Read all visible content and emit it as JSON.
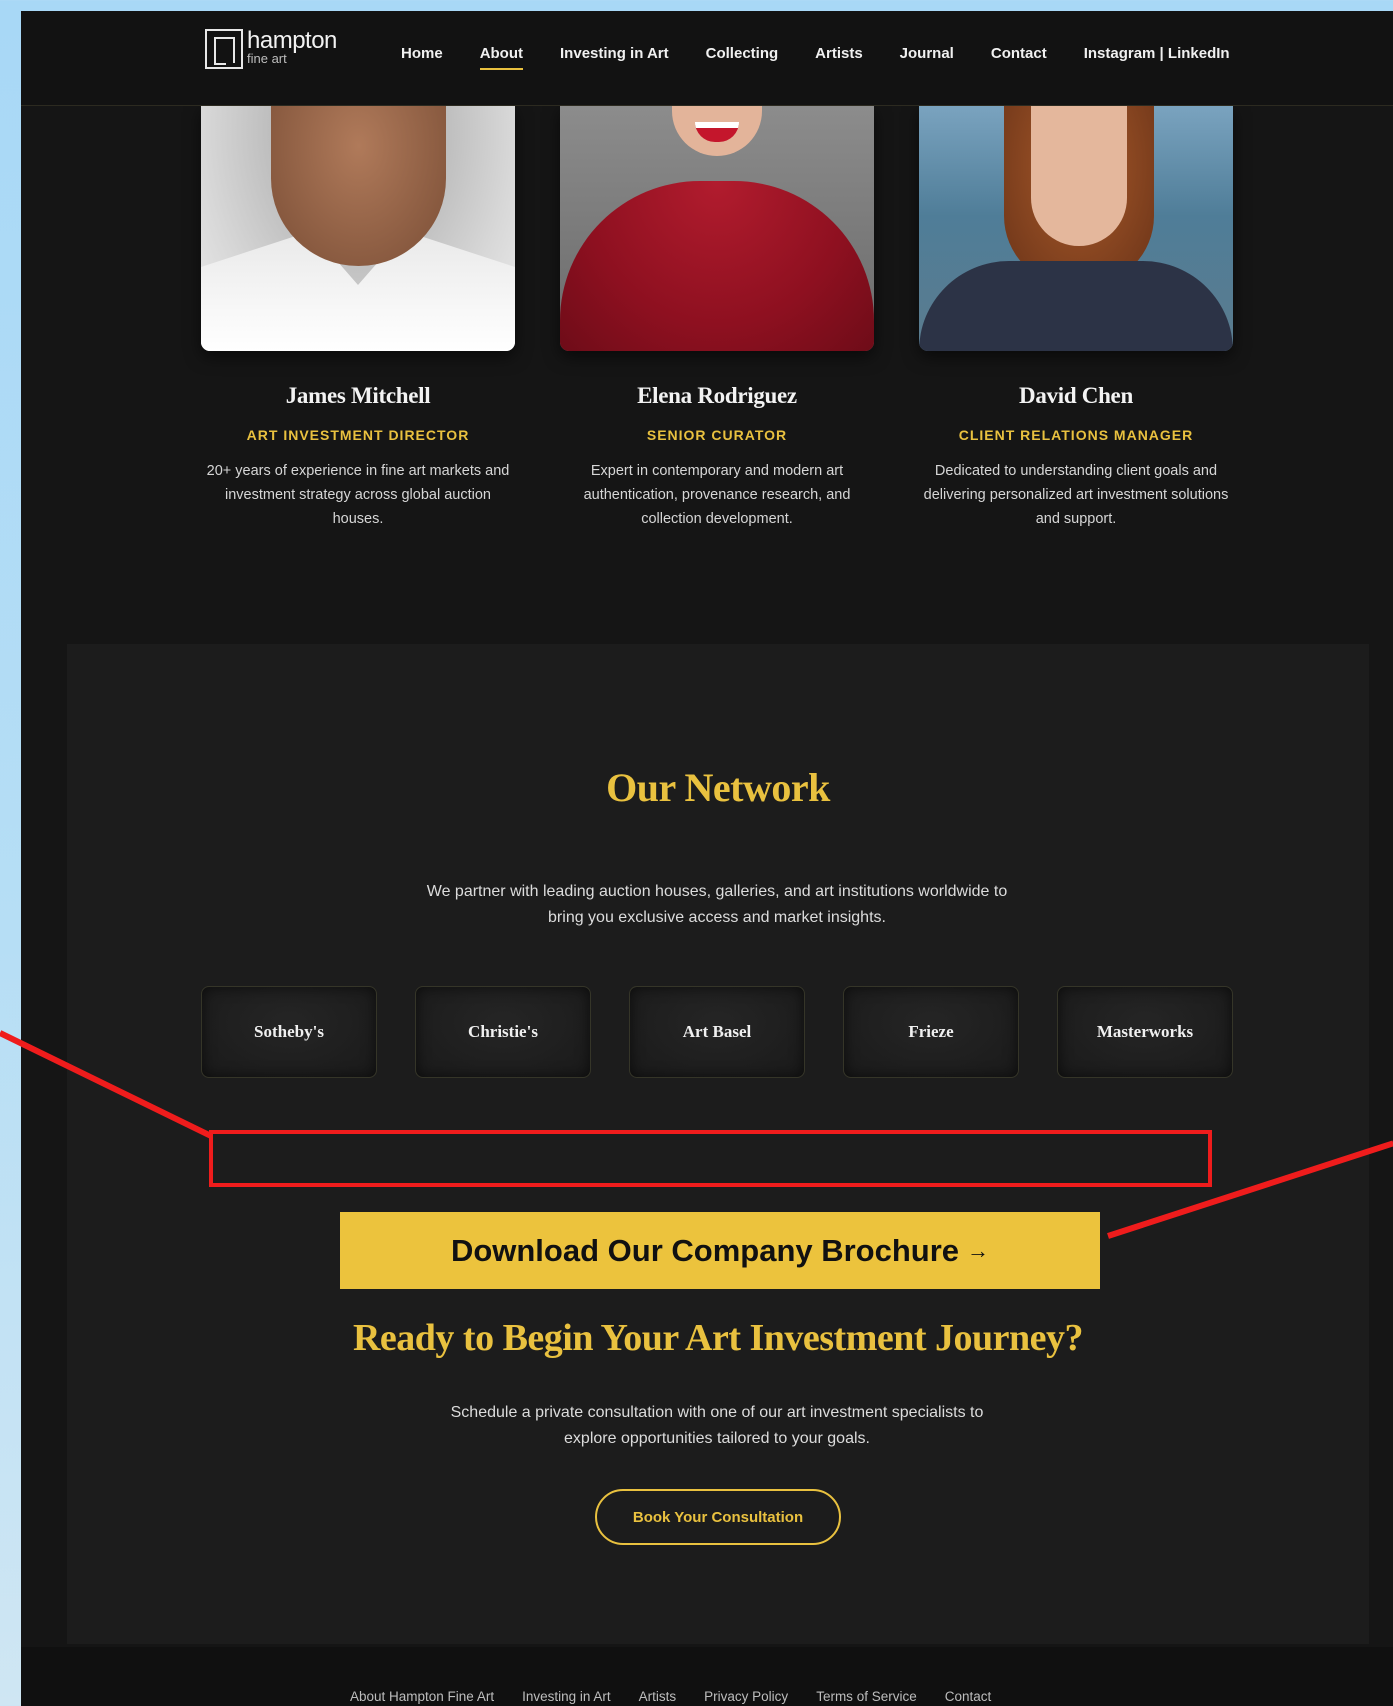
{
  "nav": {
    "logo_name": "hampton",
    "logo_sub": "fine art",
    "links": [
      "Home",
      "About",
      "Investing in Art",
      "Collecting",
      "Artists",
      "Journal",
      "Contact",
      "Instagram | LinkedIn"
    ],
    "active": "About"
  },
  "team": [
    {
      "name": "James Mitchell",
      "role": "ART INVESTMENT DIRECTOR",
      "bio": "20+ years of experience in fine art markets and investment strategy across global auction houses."
    },
    {
      "name": "Elena Rodriguez",
      "role": "SENIOR CURATOR",
      "bio": "Expert in contemporary and modern art authentication, provenance research, and collection development."
    },
    {
      "name": "David Chen",
      "role": "CLIENT RELATIONS MANAGER",
      "bio": "Dedicated to understanding client goals and delivering personalized art investment solutions and support."
    }
  ],
  "network": {
    "title": "Our Network",
    "description": "We partner with leading auction houses, galleries, and art institutions worldwide to bring you exclusive access and market insights.",
    "partners": [
      "Sotheby's",
      "Christie's",
      "Art Basel",
      "Frieze",
      "Masterworks"
    ]
  },
  "brochure_button": {
    "label": "Download Our Company Brochure",
    "arrow": "→"
  },
  "cta": {
    "title": "Ready to Begin Your Art Investment Journey?",
    "description": "Schedule a private consultation with one of our art investment specialists to explore opportunities tailored to your goals.",
    "button": "Book Your Consultation"
  },
  "footer": {
    "links": [
      "About Hampton Fine Art",
      "Investing in Art",
      "Artists",
      "Privacy Policy",
      "Terms of Service",
      "Contact"
    ]
  },
  "colors": {
    "accent": "#e9c13f",
    "button": "#ecc33d",
    "annotation": "#ef1c1c",
    "background": "#151515"
  }
}
